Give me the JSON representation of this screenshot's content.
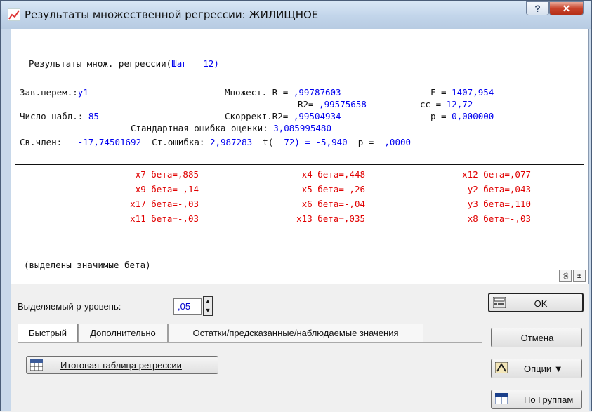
{
  "window": {
    "title": "Результаты множественной регрессии: ЖИЛИЩНОЕ",
    "help_label": "?",
    "close_label": "✕"
  },
  "results": {
    "heading_prefix": "Результаты множ. регрессии(",
    "heading_step": "Шаг   12)",
    "dep_label": "Зав.перем.:",
    "dep_value": "y1",
    "multR_label": "Множест. R = ",
    "multR_value": ",99787603",
    "F_label": "F = ",
    "F_value": "1407,954",
    "R2_label": "R2= ",
    "R2_value": ",99575658",
    "cc_label": "cc = ",
    "cc_value": "12,72",
    "nobs_label": "Число набл.: ",
    "nobs_value": "85",
    "adjR2_label": "Скоррект.R2= ",
    "adjR2_value": ",99504934",
    "p_label": "p = ",
    "p_value": "0,000000",
    "se_label": "Стандартная ошибка оценки: ",
    "se_value": "3,085995480",
    "intercept_label": "Св.член: ",
    "intercept_value": "-17,74501692",
    "interr_label": "Ст.ошибка: ",
    "interr_value": "2,987283",
    "t_label": "t(",
    "t_value": "72) = -5,940",
    "p2_label": "p = ",
    "p2_value": ",0000",
    "betas": [
      [
        "x7 бета=,885",
        "x4 бета=,448",
        "x12 бета=,077"
      ],
      [
        "x9 бета=-,14",
        "x5 бета=-,26",
        "y2 бета=,043"
      ],
      [
        "x17 бета=-,03",
        "x6 бета=-,04",
        "y3 бета=,110"
      ],
      [
        "x11 бета=-,03",
        "x13 бета=,035",
        "x8 бета=-,03"
      ]
    ],
    "note": "(выделены значимые бета)"
  },
  "controls": {
    "plevel_label": "Выделяемый p-уровень:",
    "plevel_value": ",05",
    "tabs": [
      "Быстрый",
      "Дополнительно",
      "Остатки/предсказанные/наблюдаемые значения"
    ],
    "summary_button": "Итоговая таблица регрессии",
    "ok": "OK",
    "cancel": "Отмена",
    "options": "Опции  ▼",
    "groups": "По Группам"
  },
  "colors": {
    "accent_blue": "#0000ee",
    "significant_red": "#e00000"
  }
}
